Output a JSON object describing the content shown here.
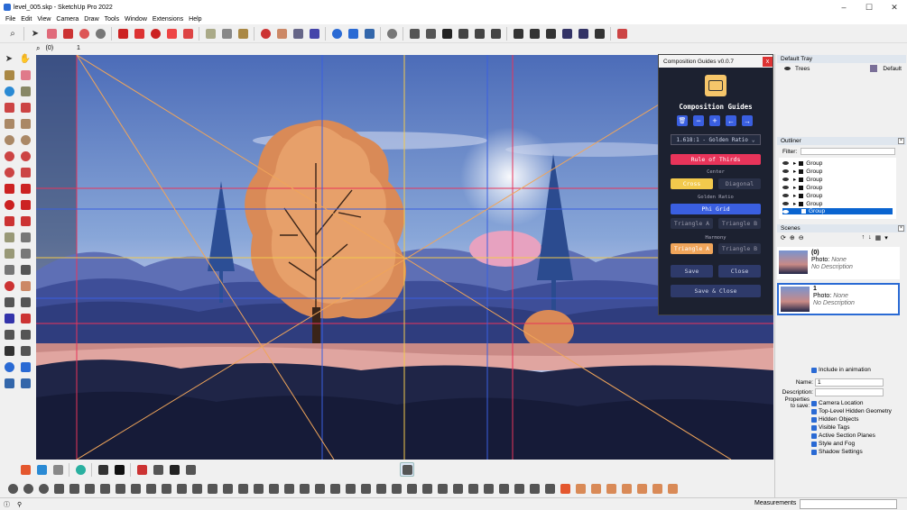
{
  "window": {
    "title": "level_005.skp - SketchUp Pro 2022"
  },
  "menu": [
    "File",
    "Edit",
    "View",
    "Camera",
    "Draw",
    "Tools",
    "Window",
    "Extensions",
    "Help"
  ],
  "toolbar2": {
    "measure_text": "(0)",
    "scene_value": "1"
  },
  "composition_guides": {
    "window_title": "Composition Guides v0.0.7",
    "close": "x",
    "heading": "Composition Guides",
    "ratio": "1.618:1 - Golden Ratio",
    "rule_of_thirds": "Rule of Thirds",
    "center_label": "Center",
    "cross": "Cross",
    "diagonal": "Diagonal",
    "golden_ratio_label": "Golden Ratio",
    "phi_grid": "Phi Grid",
    "triangle_a1": "Triangle A",
    "triangle_b1": "Triangle B",
    "harmony_label": "Harmony",
    "triangle_a2": "Triangle A",
    "triangle_b2": "Triangle B",
    "save": "Save",
    "close_btn": "Close",
    "save_close": "Save & Close",
    "colors": {
      "red": "#e8345a",
      "yellow": "#f2c94c",
      "blue": "#3a5fe0",
      "orange": "#f0a55a",
      "panel": "#1c2130"
    }
  },
  "tray": {
    "title": "Default Tray",
    "tags": {
      "name": "Trees",
      "value": "Default"
    },
    "outliner": {
      "title": "Outliner",
      "filter_label": "Filter:",
      "items": [
        "Group",
        "Group",
        "Group",
        "Group",
        "Group",
        "Group",
        "Group"
      ]
    },
    "scenes": {
      "title": "Scenes",
      "items": [
        {
          "name": "(0)",
          "photo_label": "Photo:",
          "photo": "None",
          "desc": "No Description"
        },
        {
          "name": "1",
          "photo_label": "Photo:",
          "photo": "None",
          "desc": "No Description"
        }
      ]
    },
    "props": {
      "include": "Include in animation",
      "name_label": "Name:",
      "name_value": "1",
      "desc_label": "Description:",
      "save_label": "Properties to save:",
      "options": [
        "Camera Location",
        "Top-Level Hidden Geometry",
        "Hidden Objects",
        "Visible Tags",
        "Active Section Planes",
        "Style and Fog",
        "Shadow Settings"
      ]
    }
  },
  "status": {
    "measurements": "Measurements"
  },
  "icons": {
    "app": "sketchup-icon",
    "search": "search-icon"
  }
}
